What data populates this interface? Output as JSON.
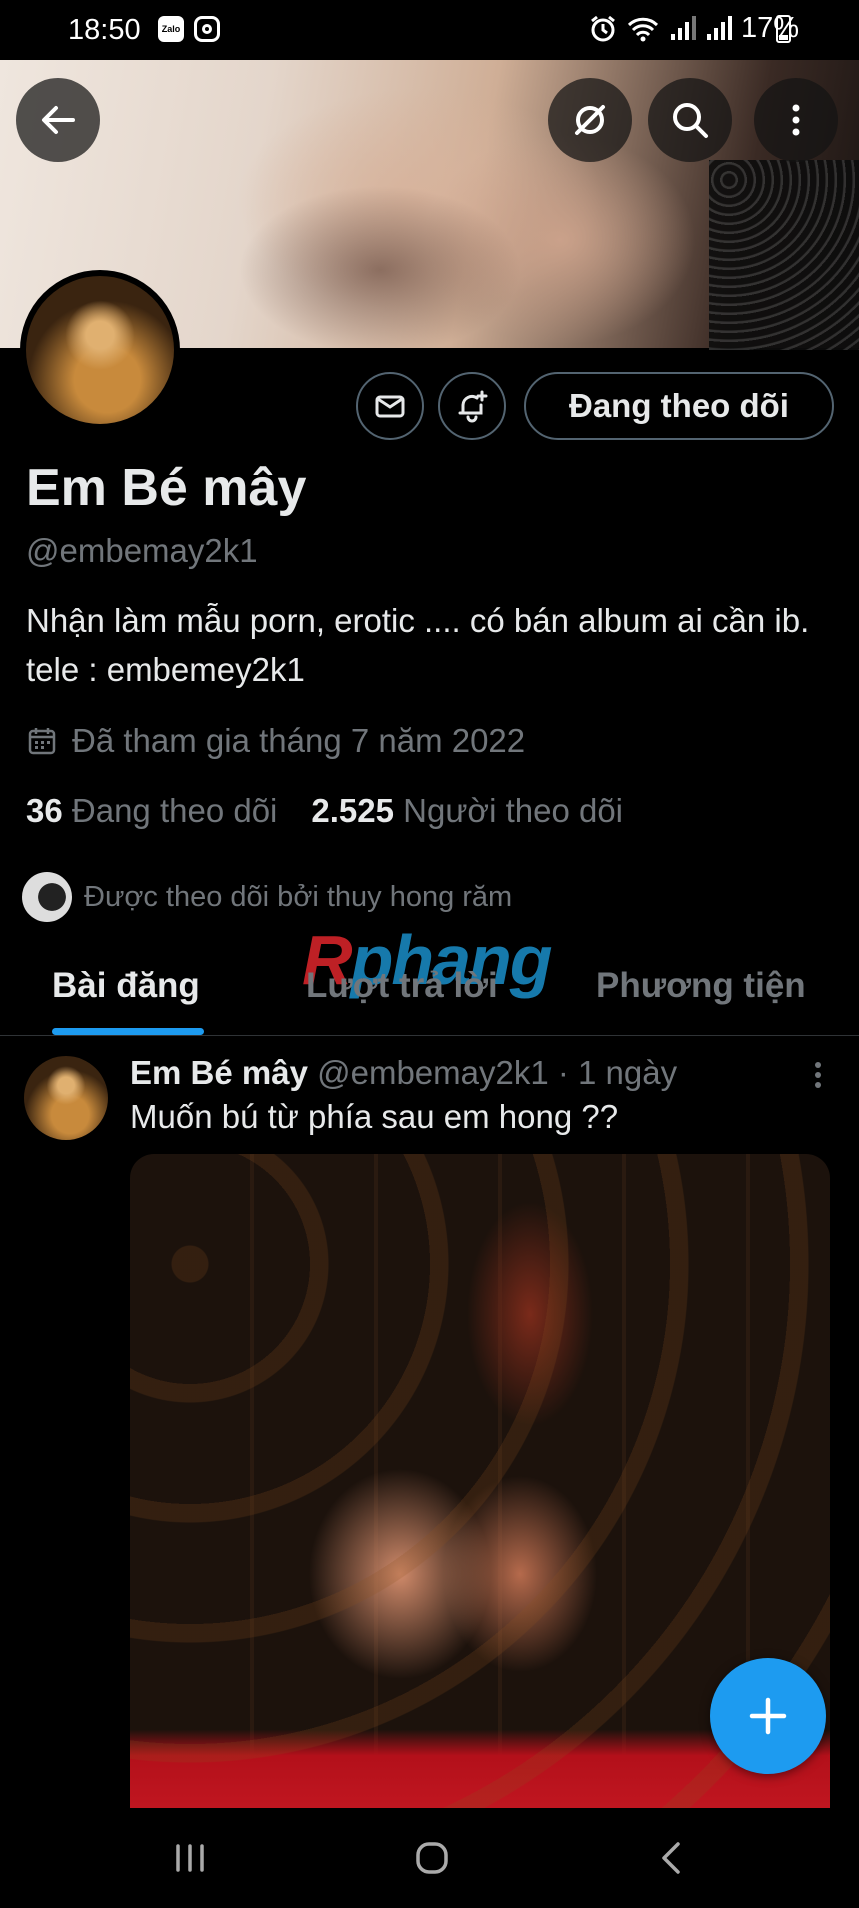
{
  "status_bar": {
    "time": "18:50",
    "zalo_label": "Zalo",
    "battery": "17%"
  },
  "profile": {
    "display_name": "Em Bé mây",
    "handle": "@embemay2k1",
    "bio": "Nhận làm mẫu porn, erotic .... có bán album ai cần ib. tele : embemey2k1",
    "joined": "Đã tham gia tháng 7 năm 2022",
    "following_count": "36",
    "following_label": "Đang theo dõi",
    "followers_count": "2.525",
    "followers_label": "Người theo dõi",
    "followed_by": "Được theo dõi bởi thuy hong răm",
    "follow_button_label": "Đang theo dõi"
  },
  "watermark": {
    "part1": "R",
    "part2": "phang"
  },
  "tabs": [
    {
      "label": "Bài đăng",
      "active": true
    },
    {
      "label": "Lượt trả lời",
      "active": false
    },
    {
      "label": "Phương tiện",
      "active": false
    }
  ],
  "tweet": {
    "name": "Em Bé mây",
    "meta": "@embemay2k1 · 1 ngày",
    "text": "Muốn bú từ phía sau em hong ??"
  },
  "icons": {
    "back": "arrow-left-icon",
    "grok": "grok-icon",
    "search": "search-icon",
    "more": "more-vertical-icon",
    "message": "envelope-icon",
    "notify": "bell-plus-icon",
    "calendar": "calendar-icon",
    "compose": "plus-icon"
  },
  "colors": {
    "accent": "#1d9bf0",
    "muted_text": "#71767b",
    "primary_text": "#e7e9ea",
    "border": "#2f3336"
  }
}
